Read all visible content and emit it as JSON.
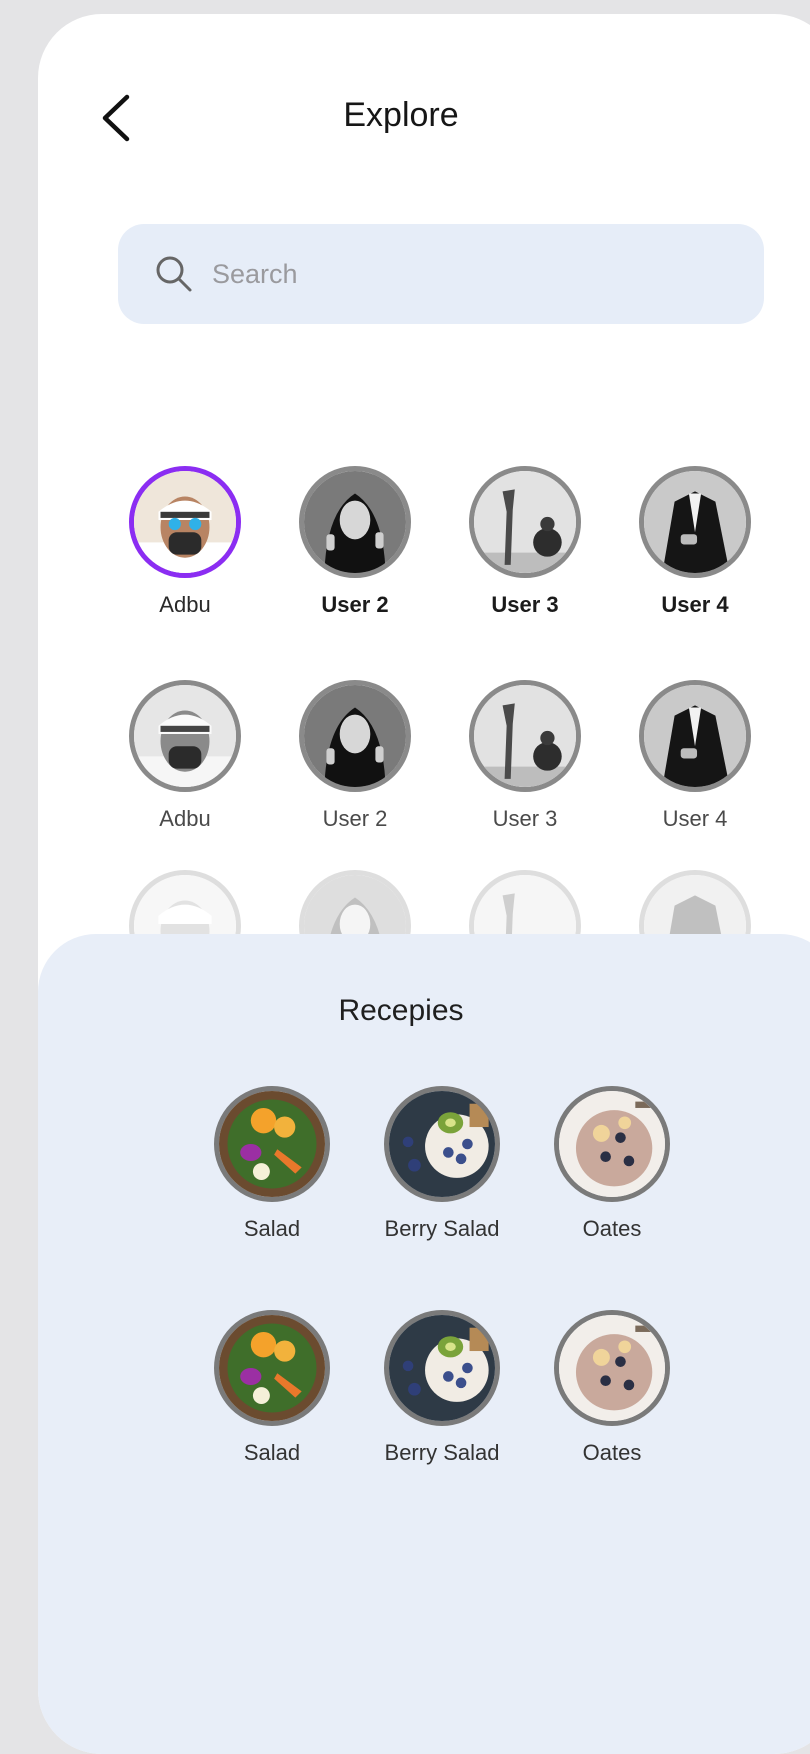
{
  "header": {
    "title": "Explore"
  },
  "search": {
    "placeholder": "Search"
  },
  "users": {
    "row1": [
      {
        "name": "Adbu",
        "active": true
      },
      {
        "name": "User 2"
      },
      {
        "name": "User 3"
      },
      {
        "name": "User 4"
      }
    ],
    "row2": [
      {
        "name": "Adbu"
      },
      {
        "name": "User 2"
      },
      {
        "name": "User 3"
      },
      {
        "name": "User 4"
      }
    ]
  },
  "recipes": {
    "title": "Recepies",
    "row1": [
      {
        "name": "Salad"
      },
      {
        "name": "Berry Salad"
      },
      {
        "name": "Oates"
      }
    ],
    "row2": [
      {
        "name": "Salad"
      },
      {
        "name": "Berry Salad"
      },
      {
        "name": "Oates"
      }
    ]
  },
  "colors": {
    "accent_ring": "#8b2df2",
    "search_bg": "#e6edf8",
    "recipes_bg": "#e8eef8"
  }
}
